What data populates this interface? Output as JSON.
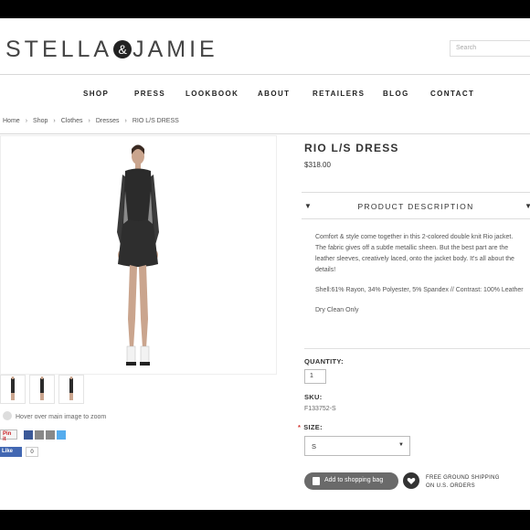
{
  "brand": {
    "left": "STELLA",
    "amp": "&",
    "right": "JAMIE"
  },
  "search": {
    "placeholder": "Search"
  },
  "nav": [
    "SHOP",
    "PRESS",
    "LOOKBOOK",
    "ABOUT",
    "RETAILERS",
    "BLOG",
    "CONTACT"
  ],
  "breadcrumb": [
    "Home",
    "Shop",
    "Clothes",
    "Dresses",
    "RIO L/S DRESS"
  ],
  "product": {
    "title": "RIO L/S DRESS",
    "price": "$318.00",
    "desc_heading": "PRODUCT DESCRIPTION",
    "desc_p1": "Comfort & style come together in this 2-colored double knit Rio jacket. The fabric gives off a subtle metallic sheen. But the best part are the leather sleeves, creatively laced, onto the jacket body. It's all about the details!",
    "desc_p2": "Shell:61% Rayon, 34% Polyester, 5% Spandex // Contrast: 100% Leather",
    "desc_p3": "Dry Clean Only",
    "quantity_label": "QUANTITY:",
    "quantity_value": "1",
    "sku_label": "SKU:",
    "sku_value": "F133752-S",
    "size_label": "SIZE:",
    "size_required": "*",
    "size_value": "S",
    "add_to_bag": "Add to shopping bag",
    "shipping_line1": "FREE GROUND SHIPPING",
    "shipping_line2": "ON U.S. ORDERS"
  },
  "gallery": {
    "zoom_hint": "Hover over main image to zoom"
  },
  "social": {
    "pin": "Pin it",
    "like": "Like",
    "like_count": "0"
  },
  "colors": {
    "dress": "#2b2b2b",
    "button": "#6a6a6a",
    "required": "#d0302b",
    "facebook": "#4267b2"
  }
}
